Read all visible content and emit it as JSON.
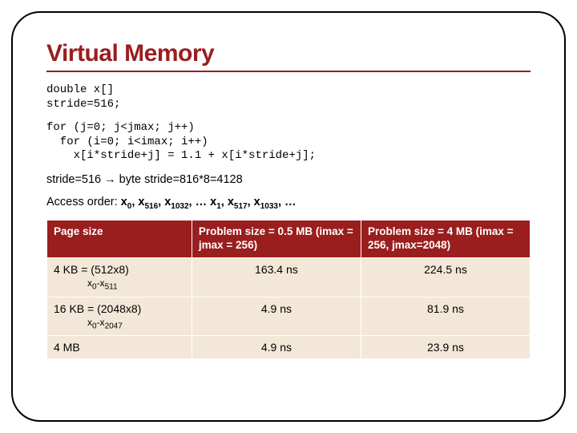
{
  "title": "Virtual Memory",
  "code_block1": "double x[]\nstride=516;",
  "code_block2": "for (j=0; j<jmax; j++)\n  for (i=0; i<imax; i++)\n    x[i*stride+j] = 1.1 + x[i*stride+j];",
  "stride_line_prefix": "stride=516 ",
  "stride_arrow": "→",
  "stride_line_suffix": " byte stride=816*8=4128",
  "access_prefix": "Access order: ",
  "access_seq": [
    "x",
    "0",
    ", ",
    "x",
    "516",
    ", ",
    "x",
    "1032",
    ", … ",
    "x",
    "1",
    ", ",
    "x",
    "517",
    ", ",
    "x",
    "1033",
    ", …"
  ],
  "table": {
    "headers": [
      "Page size",
      "Problem size = 0.5 MB (imax = jmax = 256)",
      "Problem size = 4  MB (imax = 256, jmax=2048)"
    ],
    "rows": [
      {
        "label": "4 KB = (512x8)",
        "subrange": [
          "x",
          "0",
          "-x",
          "511"
        ],
        "c1": "163.4 ns",
        "c2": "224.5 ns"
      },
      {
        "label": "16 KB = (2048x8)",
        "subrange": [
          "x",
          "0",
          "-x",
          "2047"
        ],
        "c1": "4.9 ns",
        "c2": "81.9 ns"
      },
      {
        "label": "4 MB",
        "subrange": null,
        "c1": "4.9 ns",
        "c2": "23.9 ns"
      }
    ]
  }
}
